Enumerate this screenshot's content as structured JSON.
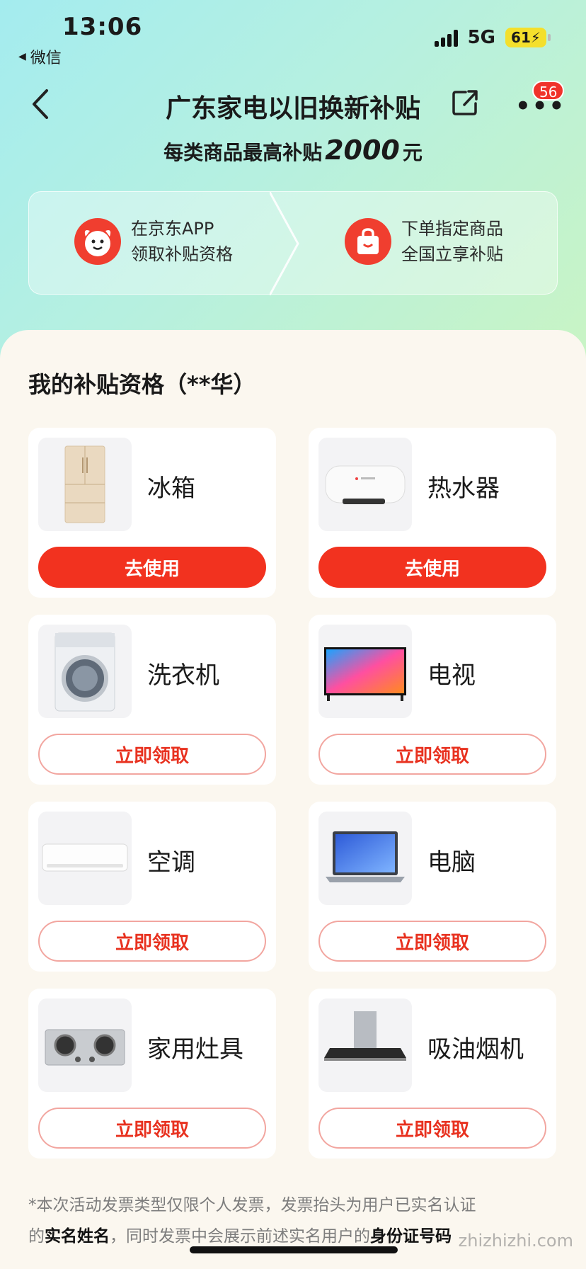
{
  "status": {
    "time": "13:06",
    "back_app": "微信",
    "network": "5G",
    "battery": "61"
  },
  "nav": {
    "title": "广东家电以旧换新补贴",
    "badge": "56"
  },
  "subtitle": {
    "prefix": "每类商品最高补贴",
    "amount": "2000",
    "suffix": "元"
  },
  "steps": [
    {
      "line1": "在京东APP",
      "line2": "领取补贴资格",
      "icon": "jd-dog-icon"
    },
    {
      "line1": "下单指定商品",
      "line2": "全国立享补贴",
      "icon": "shopping-bag-icon"
    }
  ],
  "section_title": "我的补贴资格（**华）",
  "products": [
    {
      "name": "冰箱",
      "button": "去使用",
      "icon": "fridge-icon",
      "state": "use"
    },
    {
      "name": "热水器",
      "button": "去使用",
      "icon": "water-heater-icon",
      "state": "use"
    },
    {
      "name": "洗衣机",
      "button": "立即领取",
      "icon": "washing-machine-icon",
      "state": "claim"
    },
    {
      "name": "电视",
      "button": "立即领取",
      "icon": "tv-icon",
      "state": "claim"
    },
    {
      "name": "空调",
      "button": "立即领取",
      "icon": "air-conditioner-icon",
      "state": "claim"
    },
    {
      "name": "电脑",
      "button": "立即领取",
      "icon": "laptop-icon",
      "state": "claim"
    },
    {
      "name": "家用灶具",
      "button": "立即领取",
      "icon": "gas-stove-icon",
      "state": "claim"
    },
    {
      "name": "吸油烟机",
      "button": "立即领取",
      "icon": "range-hood-icon",
      "state": "claim"
    }
  ],
  "footer": {
    "line1": "*本次活动发票类型仅限个人发票，发票抬头为用户已实名认证",
    "line2_a": "的",
    "line2_b": "实名姓名",
    "line2_c": "，同时发票中会展示前述实名用户的",
    "line2_d": "身份证号码"
  },
  "watermark": "zhizhizhi.com",
  "colors": {
    "accent": "#f2321f",
    "bg_top": "#a4ecef",
    "panel": "#fbf7ef"
  }
}
